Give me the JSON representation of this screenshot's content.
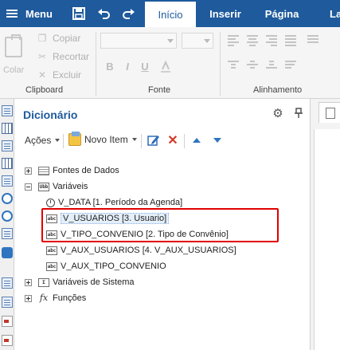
{
  "menu": {
    "label": "Menu"
  },
  "tabs": [
    {
      "label": "Início",
      "active": true
    },
    {
      "label": "Inserir",
      "active": false
    },
    {
      "label": "Página",
      "active": false
    },
    {
      "label": "La",
      "active": false
    }
  ],
  "ribbon": {
    "clipboard": {
      "paste_label": "Colar",
      "copy_label": "Copiar",
      "cut_label": "Recortar",
      "delete_label": "Excluir",
      "group_label": "Clipboard"
    },
    "font": {
      "bold": "B",
      "italic": "I",
      "underline": "U",
      "group_label": "Fonte"
    },
    "alignment": {
      "group_label": "Alinhamento"
    }
  },
  "dictionary": {
    "title": "Dicionário",
    "toolbar": {
      "actions_label": "Ações",
      "new_item_label": "Novo Item",
      "remove_symbol": "✕"
    },
    "tree": [
      {
        "label": "Fontes de Dados",
        "expander": "plus",
        "icon": "database-icon"
      },
      {
        "label": "Variáveis",
        "expander": "minus",
        "icon": "variables-icon",
        "icon_text": "Ubb"
      },
      {
        "label": "V_DATA [1. Período da Agenda]",
        "icon": "clock-icon"
      },
      {
        "label": "V_USUARIOS [3. Usuario]",
        "icon": "text-variable-icon",
        "icon_text": "abc",
        "selected": true
      },
      {
        "label": "V_TIPO_CONVENIO [2. Tipo de Convênio]",
        "icon": "text-variable-icon",
        "icon_text": "abc"
      },
      {
        "label": "V_AUX_USUARIOS [4. V_AUX_USUARIOS]",
        "icon": "text-variable-icon",
        "icon_text": "abc"
      },
      {
        "label": "V_AUX_TIPO_CONVENIO",
        "icon": "text-variable-icon",
        "icon_text": "abc"
      },
      {
        "label": "Variáveis de Sistema",
        "expander": "plus",
        "icon": "system-variables-icon",
        "icon_text": "Σ"
      },
      {
        "label": "Funções",
        "expander": "plus",
        "icon": "function-icon",
        "icon_text": "fx"
      }
    ]
  },
  "colors": {
    "accent": "#1e5a9c",
    "highlight_box": "#e00000",
    "action_blue": "#2f74c0",
    "remove_red": "#d43a2a"
  }
}
